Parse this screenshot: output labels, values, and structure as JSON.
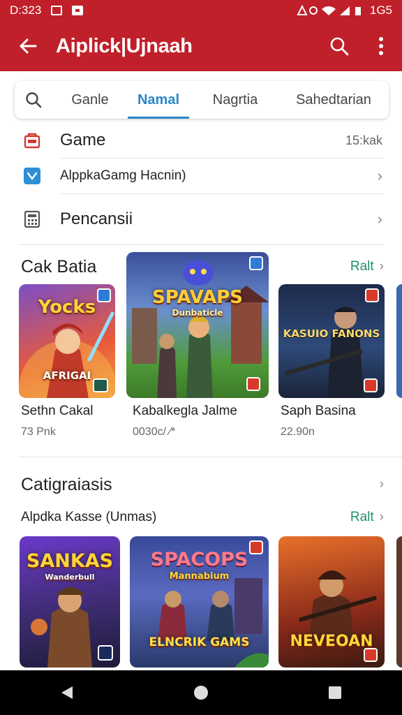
{
  "status": {
    "time": "D:323",
    "right": "1G5"
  },
  "toolbar": {
    "title": "Aiplick|Ujnaah"
  },
  "tabs": [
    {
      "label": "Ganle"
    },
    {
      "label": "Namal"
    },
    {
      "label": "Nagrtia"
    },
    {
      "label": "Sahedtarian"
    }
  ],
  "list": {
    "game": {
      "label": "Game",
      "meta": "15:kak"
    },
    "alpk": {
      "label": "AlppkaGamg Hacnin)"
    },
    "pencansii": {
      "label": "Pencansii"
    }
  },
  "section1": {
    "title": "Cak Batia",
    "see_all": "Ralt",
    "cards": [
      {
        "title": "Sethn Cakal",
        "meta": "73 Pnk",
        "cover": "Yocks",
        "banner": "AFRIGAI"
      },
      {
        "title": "Kabalkegla Jalme",
        "meta": "0030c/ ⁄*",
        "cover": "SPAVAPS",
        "banner": "Dunbaticle"
      },
      {
        "title": "Saph Basina",
        "meta": "22.90n",
        "cover": "KASUIO FANONS"
      }
    ]
  },
  "section2": {
    "title": "Catigraiasis",
    "subtitle": "Alpdka Kasse (Unmas)",
    "see_all": "Ralt",
    "covers": [
      {
        "title": "SANKAS",
        "sub": "Wanderbull"
      },
      {
        "title": "SPACOPS",
        "sub": "Mannabium",
        "footer": "ELNCRIK GAMS"
      },
      {
        "title": "NEVEOAN"
      }
    ]
  },
  "colors": {
    "appbar": "#c0202a",
    "accent": "#2a86c8",
    "link": "#1f8f6a"
  },
  "icons": {
    "back": "arrow-left-icon",
    "search": "search-icon",
    "more": "more-vert-icon",
    "game": "bag-icon",
    "alpk": "app-icon",
    "pencansii": "calculator-icon"
  }
}
